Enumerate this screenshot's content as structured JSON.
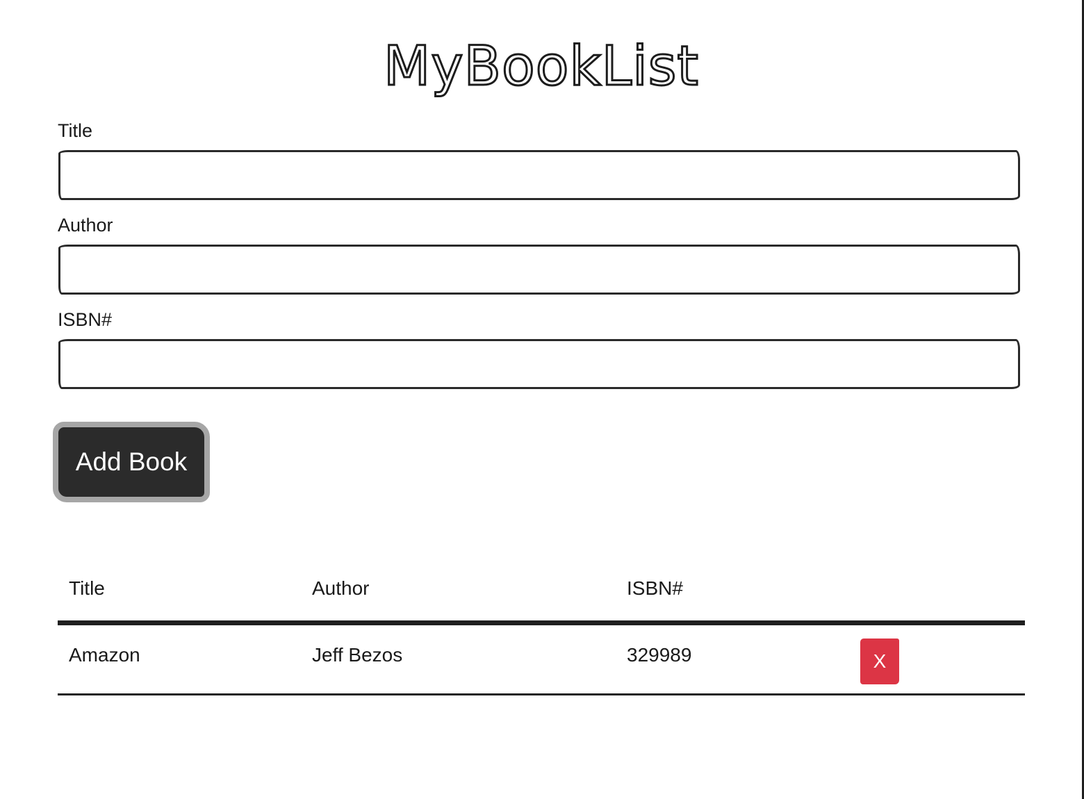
{
  "app": {
    "title": "MyBookList"
  },
  "form": {
    "title_label": "Title",
    "title_value": "",
    "author_label": "Author",
    "author_value": "",
    "isbn_label": "ISBN#",
    "isbn_value": "",
    "submit_label": "Add Book"
  },
  "table": {
    "headers": [
      "Title",
      "Author",
      "ISBN#",
      ""
    ],
    "rows": [
      {
        "title": "Amazon",
        "author": "Jeff Bezos",
        "isbn": "329989",
        "delete_label": "X"
      }
    ]
  },
  "colors": {
    "primary_dark": "#2b2b2b",
    "button_border": "#a6a6a6",
    "danger": "#dc3545",
    "background": "#ffffff"
  }
}
